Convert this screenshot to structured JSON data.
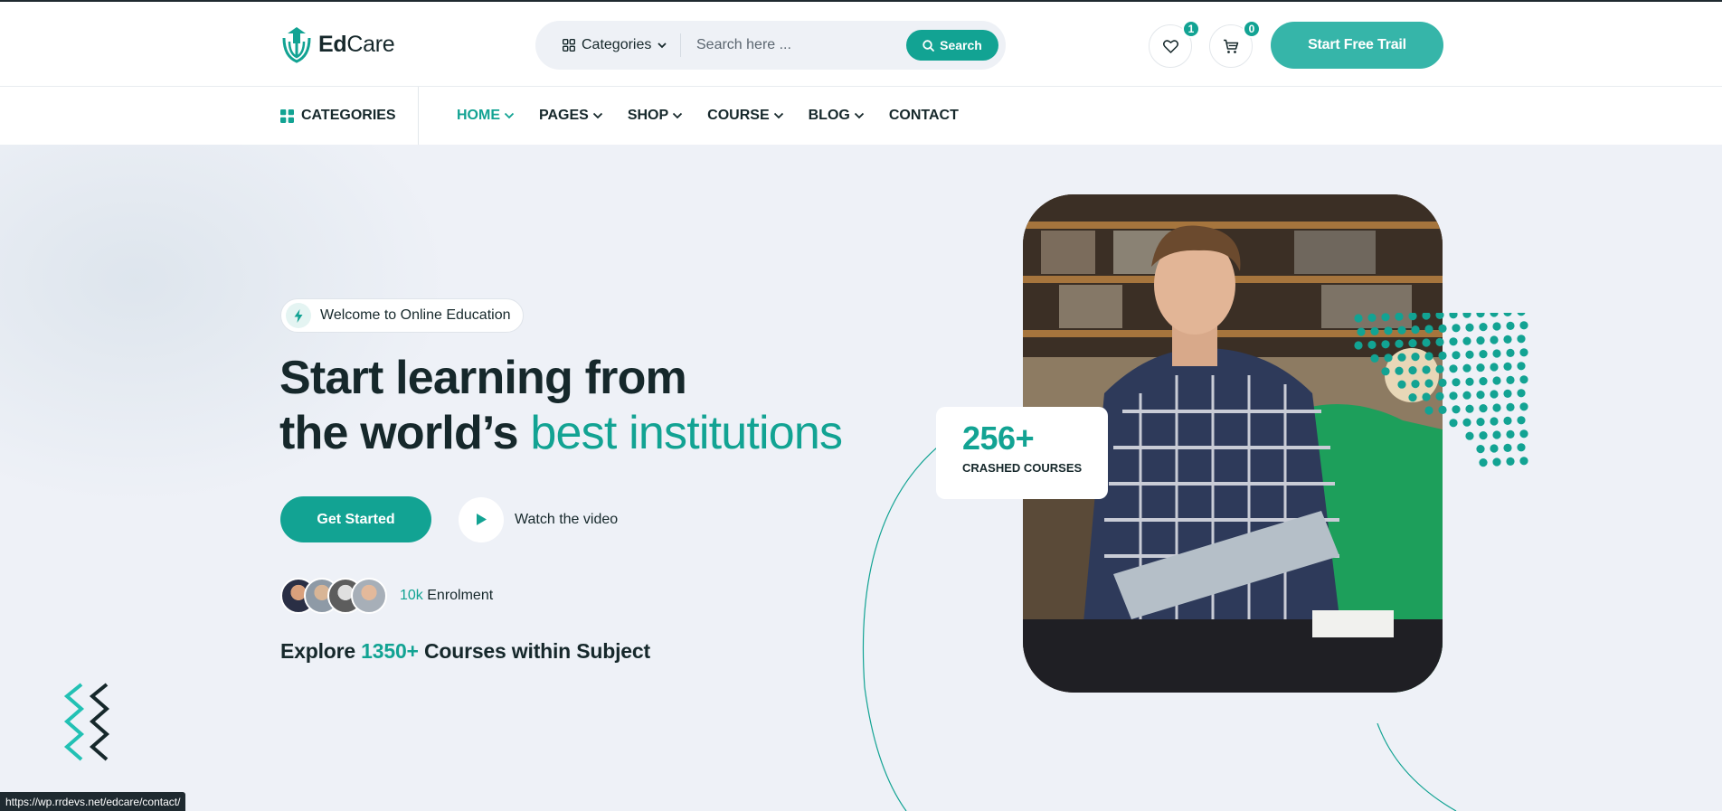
{
  "brand": {
    "name_bold": "Ed",
    "name_rest": "Care"
  },
  "search": {
    "category_label": "Categories",
    "placeholder": "Search here ...",
    "button_label": "Search"
  },
  "header": {
    "wishlist_count": "1",
    "cart_count": "0",
    "trial_button": "Start Free Trail"
  },
  "nav": {
    "categories_label": "CATEGORIES",
    "items": [
      {
        "label": "HOME",
        "has_dropdown": true,
        "active": true
      },
      {
        "label": "PAGES",
        "has_dropdown": true,
        "active": false
      },
      {
        "label": "SHOP",
        "has_dropdown": true,
        "active": false
      },
      {
        "label": "COURSE",
        "has_dropdown": true,
        "active": false
      },
      {
        "label": "BLOG",
        "has_dropdown": true,
        "active": false
      },
      {
        "label": "CONTACT",
        "has_dropdown": false,
        "active": false
      }
    ]
  },
  "hero": {
    "welcome": "Welcome to Online Education",
    "title_line1": "Start learning from",
    "title_line2_plain": "the world’s",
    "title_line2_accent": "best institutions",
    "primary_button": "Get Started",
    "video_label": "Watch the video",
    "enrol_number": "10k",
    "enrol_label": "Enrolment",
    "explore_prefix": "Explore",
    "explore_number": "1350+",
    "explore_suffix": "Courses within Subject"
  },
  "stat": {
    "number": "256+",
    "label": "CRASHED COURSES"
  },
  "status_bar": {
    "url": "https://wp.rrdevs.net/edcare/contact/"
  },
  "colors": {
    "accent": "#12a393",
    "accent_light": "#36b5a9",
    "dark": "#16282b",
    "hero_bg": "#eef1f7"
  },
  "icons": [
    "edcare-logo-icon",
    "grid-icon",
    "chevron-down-icon",
    "search-icon",
    "heart-icon",
    "cart-icon",
    "bolt-icon",
    "play-icon",
    "zigzag-decoration-icon"
  ]
}
